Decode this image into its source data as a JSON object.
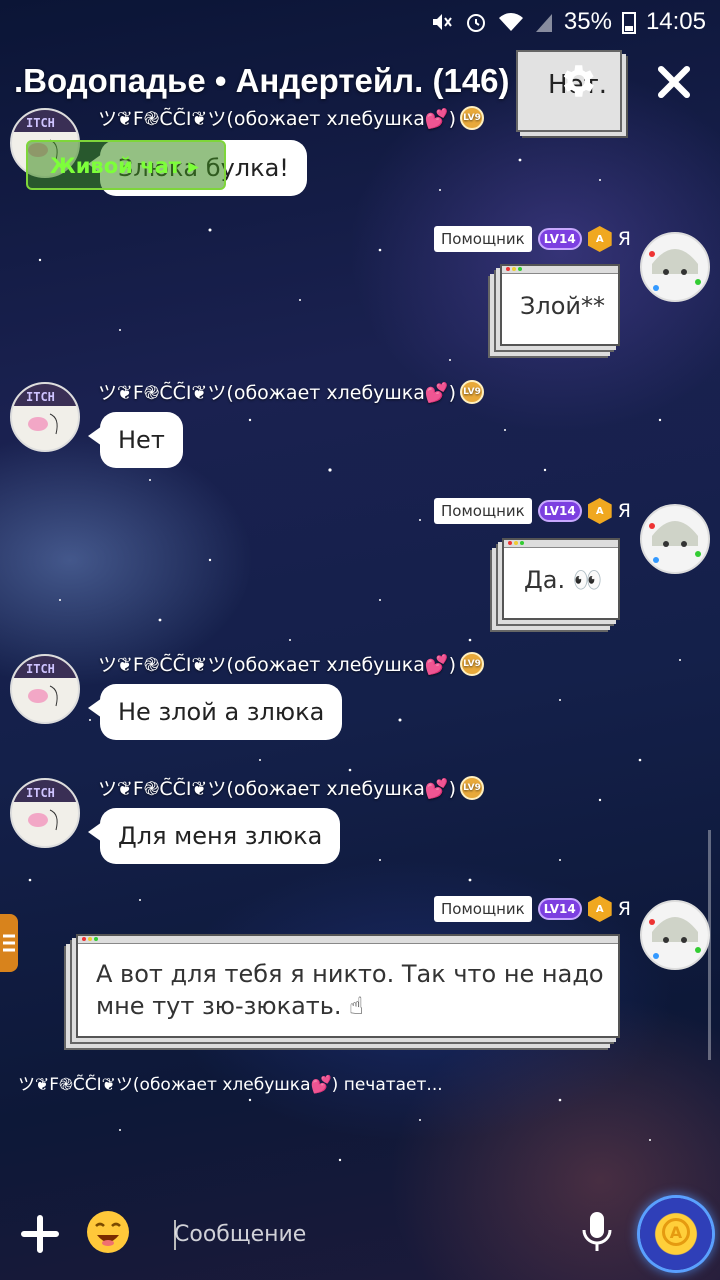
{
  "status_bar": {
    "battery": "35%",
    "time": "14:05"
  },
  "header": {
    "title": ".Водопадье • Андертейл. (146)",
    "peek_text": "Нет."
  },
  "live_chat_label": "Живой чат ▸",
  "other_user": {
    "name": "ツ❦F֎C̃C̃I❦ツ(обожает хлебушка💕)"
  },
  "me": {
    "role_tag": "Помощник",
    "level": "LV14",
    "label": "Я",
    "hex_badge": "A"
  },
  "messages": [
    {
      "text": "Злюка булка!"
    },
    {
      "text": "Злой**"
    },
    {
      "text": "Нет"
    },
    {
      "text": "Да. 👀"
    },
    {
      "text": "Не злой а злюка"
    },
    {
      "text": "Для меня злюка"
    },
    {
      "text": "А вот для тебя я никто. Так что не надо\nмне тут зю-зюкать. ☝"
    }
  ],
  "typing_indicator": "ツ❦F֎C̃C̃I❦ツ(обожает хлебушка💕) печатает...",
  "composer": {
    "placeholder": "Сообщение"
  },
  "colors": {
    "accent_green": "#7dff3a",
    "helper_purple": "#7c3fe0",
    "coin_gold": "#f0a820"
  }
}
